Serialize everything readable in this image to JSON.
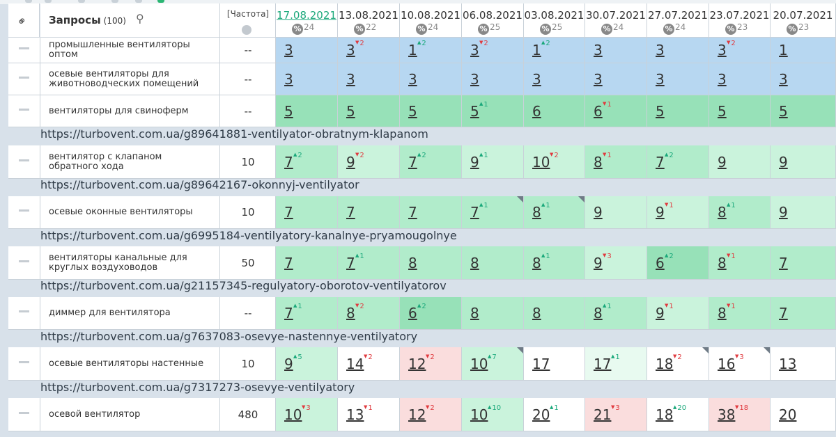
{
  "colors": {
    "blue": "#b7d7f1",
    "green_strong": "#97e1b8",
    "green_mid": "#b1eccb",
    "green_light": "#caf3dc",
    "green_pale": "#e8faf0",
    "red_pale": "#fadddd",
    "white": "#ffffff",
    "up": "#19a87a",
    "down": "#e0393e"
  },
  "header": {
    "link_icon": "link-icon",
    "queries_label": "Запросы",
    "queries_count": "(100)",
    "search_icon": "search-icon",
    "frequency_label": "[Частота]",
    "globe_icon": "globe-icon",
    "percent_icon": "percent-icon",
    "dates": [
      {
        "date": "17.08.2021",
        "pct": "24",
        "active": true
      },
      {
        "date": "13.08.2021",
        "pct": "22",
        "active": false
      },
      {
        "date": "10.08.2021",
        "pct": "24",
        "active": false
      },
      {
        "date": "06.08.2021",
        "pct": "25",
        "active": false
      },
      {
        "date": "03.08.2021",
        "pct": "25",
        "active": false
      },
      {
        "date": "30.07.2021",
        "pct": "24",
        "active": false
      },
      {
        "date": "27.07.2021",
        "pct": "24",
        "active": false
      },
      {
        "date": "23.07.2021",
        "pct": "23",
        "active": false
      },
      {
        "date": "20.07.2021",
        "pct": "23",
        "active": false
      }
    ]
  },
  "groups": [
    {
      "url": "",
      "rows": [
        {
          "query": "промышленные вентиляторы оптом",
          "freq": "--",
          "cells": [
            {
              "v": "3",
              "c": "blue"
            },
            {
              "v": "3",
              "d": "2",
              "dir": "down",
              "c": "blue"
            },
            {
              "v": "1",
              "d": "2",
              "dir": "up",
              "c": "blue"
            },
            {
              "v": "3",
              "d": "2",
              "dir": "down",
              "c": "blue"
            },
            {
              "v": "1",
              "d": "2",
              "dir": "up",
              "c": "blue"
            },
            {
              "v": "3",
              "c": "blue"
            },
            {
              "v": "3",
              "c": "blue"
            },
            {
              "v": "3",
              "d": "2",
              "dir": "down",
              "c": "blue"
            },
            {
              "v": "1",
              "c": "blue"
            }
          ]
        },
        {
          "query": "осевые вентиляторы для животноводческих помещений",
          "freq": "--",
          "cells": [
            {
              "v": "3",
              "c": "blue"
            },
            {
              "v": "3",
              "c": "blue"
            },
            {
              "v": "3",
              "c": "blue"
            },
            {
              "v": "3",
              "c": "blue"
            },
            {
              "v": "3",
              "c": "blue"
            },
            {
              "v": "3",
              "c": "blue"
            },
            {
              "v": "3",
              "c": "blue"
            },
            {
              "v": "3",
              "c": "blue"
            },
            {
              "v": "3",
              "c": "blue"
            }
          ]
        },
        {
          "query": "вентиляторы для свиноферм",
          "freq": "--",
          "cells": [
            {
              "v": "5",
              "c": "green_strong"
            },
            {
              "v": "5",
              "c": "green_strong"
            },
            {
              "v": "5",
              "c": "green_strong"
            },
            {
              "v": "5",
              "d": "1",
              "dir": "up",
              "c": "green_strong"
            },
            {
              "v": "6",
              "c": "green_strong"
            },
            {
              "v": "6",
              "d": "1",
              "dir": "down",
              "c": "green_strong"
            },
            {
              "v": "5",
              "c": "green_strong"
            },
            {
              "v": "5",
              "c": "green_strong"
            },
            {
              "v": "5",
              "c": "green_strong"
            }
          ]
        }
      ]
    },
    {
      "url": "https://turbovent.com.ua/g89641881-ventilyator-obratnym-klapanom",
      "rows": [
        {
          "query": "вентилятор с клапаном обратного хода",
          "freq": "10",
          "cells": [
            {
              "v": "7",
              "d": "2",
              "dir": "up",
              "c": "green_mid"
            },
            {
              "v": "9",
              "d": "2",
              "dir": "down",
              "c": "green_light"
            },
            {
              "v": "7",
              "d": "2",
              "dir": "up",
              "c": "green_mid"
            },
            {
              "v": "9",
              "d": "1",
              "dir": "up",
              "c": "green_light"
            },
            {
              "v": "10",
              "d": "2",
              "dir": "down",
              "c": "green_light"
            },
            {
              "v": "8",
              "d": "1",
              "dir": "down",
              "c": "green_mid"
            },
            {
              "v": "7",
              "d": "2",
              "dir": "up",
              "c": "green_mid"
            },
            {
              "v": "9",
              "c": "green_light"
            },
            {
              "v": "9",
              "c": "green_light"
            }
          ]
        }
      ]
    },
    {
      "url": "https://turbovent.com.ua/g89642167-okonnyj-ventilyator",
      "rows": [
        {
          "query": "осевые оконные вентиляторы",
          "freq": "10",
          "cells": [
            {
              "v": "7",
              "c": "green_mid"
            },
            {
              "v": "7",
              "c": "green_mid"
            },
            {
              "v": "7",
              "c": "green_mid"
            },
            {
              "v": "7",
              "d": "1",
              "dir": "up",
              "c": "green_mid",
              "corner": true
            },
            {
              "v": "8",
              "d": "1",
              "dir": "up",
              "c": "green_mid",
              "corner": true
            },
            {
              "v": "9",
              "c": "green_light"
            },
            {
              "v": "9",
              "d": "1",
              "dir": "down",
              "c": "green_light"
            },
            {
              "v": "8",
              "d": "1",
              "dir": "up",
              "c": "green_mid"
            },
            {
              "v": "9",
              "c": "green_light"
            }
          ]
        }
      ]
    },
    {
      "url": "https://turbovent.com.ua/g6995184-ventilyatory-kanalnye-pryamougolnye",
      "rows": [
        {
          "query": "вентиляторы канальные для круглых воздуховодов",
          "freq": "50",
          "cells": [
            {
              "v": "7",
              "c": "green_mid"
            },
            {
              "v": "7",
              "d": "1",
              "dir": "up",
              "c": "green_mid"
            },
            {
              "v": "8",
              "c": "green_mid"
            },
            {
              "v": "8",
              "c": "green_mid"
            },
            {
              "v": "8",
              "d": "1",
              "dir": "up",
              "c": "green_mid"
            },
            {
              "v": "9",
              "d": "3",
              "dir": "down",
              "c": "green_light"
            },
            {
              "v": "6",
              "d": "2",
              "dir": "up",
              "c": "green_strong"
            },
            {
              "v": "8",
              "d": "1",
              "dir": "down",
              "c": "green_mid"
            },
            {
              "v": "7",
              "c": "green_mid"
            }
          ]
        }
      ]
    },
    {
      "url": "https://turbovent.com.ua/g21157345-regulyatory-oborotov-ventilyatorov",
      "rows": [
        {
          "query": "диммер для вентилятора",
          "freq": "--",
          "cells": [
            {
              "v": "7",
              "d": "1",
              "dir": "up",
              "c": "green_mid"
            },
            {
              "v": "8",
              "d": "2",
              "dir": "down",
              "c": "green_mid"
            },
            {
              "v": "6",
              "d": "2",
              "dir": "up",
              "c": "green_strong"
            },
            {
              "v": "8",
              "c": "green_mid"
            },
            {
              "v": "8",
              "c": "green_mid"
            },
            {
              "v": "8",
              "d": "1",
              "dir": "up",
              "c": "green_mid"
            },
            {
              "v": "9",
              "d": "1",
              "dir": "down",
              "c": "green_light"
            },
            {
              "v": "8",
              "d": "1",
              "dir": "down",
              "c": "green_mid"
            },
            {
              "v": "7",
              "c": "green_mid"
            }
          ]
        }
      ]
    },
    {
      "url": "https://turbovent.com.ua/g7637083-osevye-nastennye-ventilyatory",
      "rows": [
        {
          "query": "осевые вентиляторы настенные",
          "freq": "10",
          "cells": [
            {
              "v": "9",
              "d": "5",
              "dir": "up",
              "c": "green_light"
            },
            {
              "v": "14",
              "d": "2",
              "dir": "down",
              "c": "white"
            },
            {
              "v": "12",
              "d": "2",
              "dir": "down",
              "c": "red_pale"
            },
            {
              "v": "10",
              "d": "7",
              "dir": "up",
              "c": "green_light",
              "corner": true
            },
            {
              "v": "17",
              "c": "white"
            },
            {
              "v": "17",
              "d": "1",
              "dir": "up",
              "c": "green_pale"
            },
            {
              "v": "18",
              "d": "2",
              "dir": "down",
              "c": "white",
              "corner": true
            },
            {
              "v": "16",
              "d": "3",
              "dir": "down",
              "c": "white",
              "corner": true
            },
            {
              "v": "13",
              "c": "white"
            }
          ]
        }
      ]
    },
    {
      "url": "https://turbovent.com.ua/g7317273-osevye-ventilyatory",
      "rows": [
        {
          "query": "осевой вентилятор",
          "freq": "480",
          "cells": [
            {
              "v": "10",
              "d": "3",
              "dir": "down",
              "c": "green_light"
            },
            {
              "v": "13",
              "d": "1",
              "dir": "down",
              "c": "white"
            },
            {
              "v": "12",
              "d": "2",
              "dir": "down",
              "c": "red_pale"
            },
            {
              "v": "10",
              "d": "10",
              "dir": "up",
              "c": "green_light"
            },
            {
              "v": "20",
              "d": "1",
              "dir": "up",
              "c": "white"
            },
            {
              "v": "21",
              "d": "3",
              "dir": "down",
              "c": "red_pale"
            },
            {
              "v": "18",
              "d": "20",
              "dir": "up",
              "c": "white"
            },
            {
              "v": "38",
              "d": "18",
              "dir": "down",
              "c": "red_pale"
            },
            {
              "v": "20",
              "c": "white"
            }
          ]
        }
      ]
    }
  ]
}
